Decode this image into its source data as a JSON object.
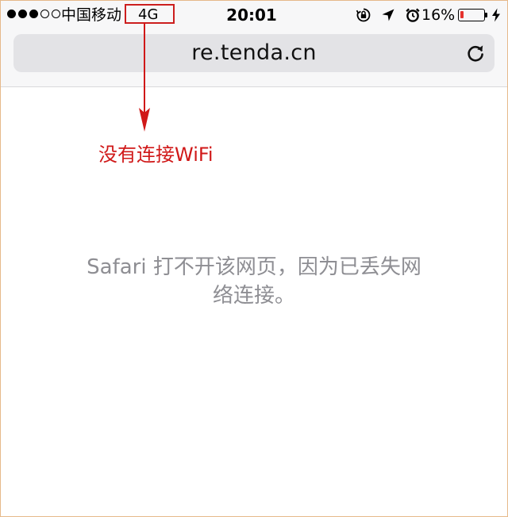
{
  "status_bar": {
    "carrier": "中国移动",
    "network": "4G",
    "time": "20:01",
    "battery_percent": "16%",
    "battery_level": 0.16,
    "signal_bars": 5,
    "signal_filled": 3,
    "icons": [
      "orientation-lock-icon",
      "location-arrow-icon",
      "alarm-icon",
      "battery-icon",
      "charging-bolt-icon"
    ]
  },
  "address_bar": {
    "url": "re.tenda.cn",
    "reload_icon": "reload-icon"
  },
  "annotation": {
    "text": "没有连接WiFi",
    "color": "#d01818"
  },
  "page": {
    "error_line1": "Safari 打不开该网页，因为已丢失网",
    "error_line2": "络连接。"
  }
}
